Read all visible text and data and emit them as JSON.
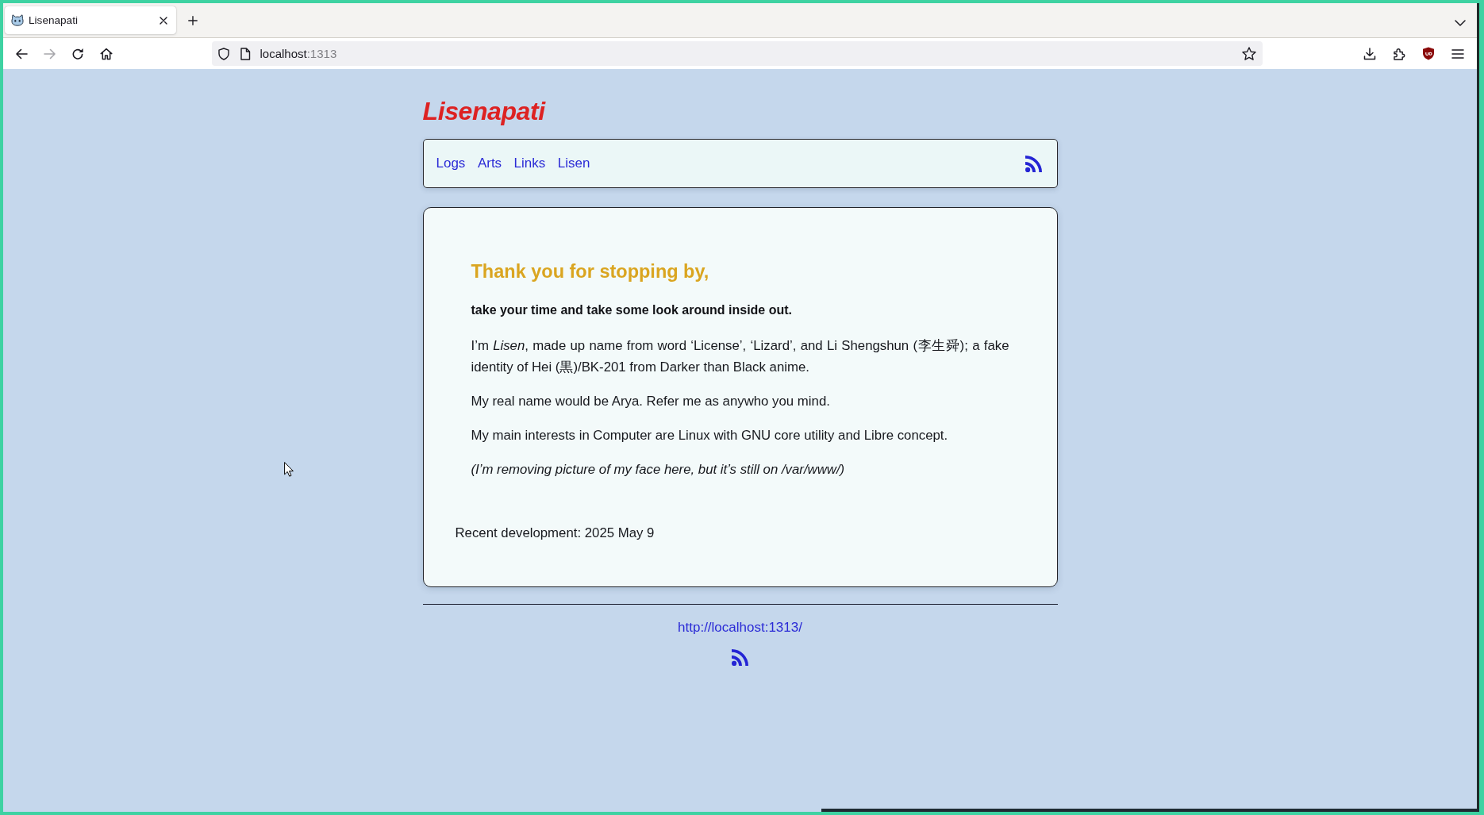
{
  "browser": {
    "tabs": [
      {
        "title": "Lisenapati",
        "selected": true
      }
    ],
    "toolbar": [
      {
        "kind": "back",
        "disabled": false
      },
      {
        "kind": "forward",
        "disabled": true
      },
      {
        "kind": "reload",
        "disabled": false
      },
      {
        "kind": "home",
        "disabled": false
      }
    ],
    "address_bar": {
      "host": "localhost",
      "port": ":1313"
    }
  },
  "site": {
    "title": "Lisenapati",
    "nav": [
      {
        "label": "Logs"
      },
      {
        "label": "Arts"
      },
      {
        "label": "Links"
      },
      {
        "label": "Lisen"
      }
    ]
  },
  "article": {
    "heading": "Thank you for stopping by,",
    "lead": "take your time and take some look around inside out.",
    "paragraphs": [
      {
        "kind": "text",
        "text": "I’m *Lisen*, made up name from word ‘License’, ‘Lizard’, and Li Shengshun (李生舜); a fake identity of Hei (黒)/BK-201 from Darker than Black anime."
      },
      {
        "kind": "text",
        "text": "My real name would be Arya. Refer me as anywho you mind."
      },
      {
        "kind": "text",
        "text": "My main interests in Computer are Linux with GNU core utility and Libre concept."
      },
      {
        "kind": "note",
        "text": "(I’m removing picture of my face here, but it’s still on /var/www/)"
      }
    ],
    "recent_development": "Recent development: 2025 May 9"
  },
  "footer": {
    "link": "http://localhost:1313/"
  }
}
